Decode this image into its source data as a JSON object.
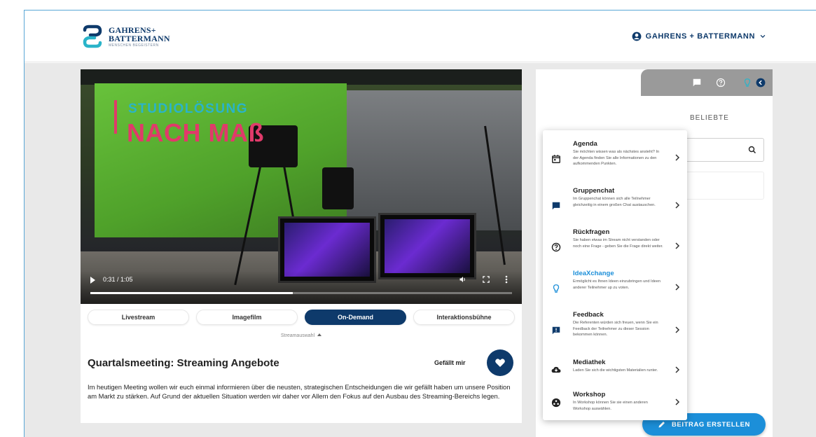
{
  "header": {
    "brand_name_line1": "GAHRENS+",
    "brand_name_line2": "BATTERMANN",
    "brand_tagline": "MENSCHEN BEGEISTERN",
    "account_name": "GAHRENS + BATTERMANN"
  },
  "video": {
    "overlay_line1": "STUDIOLÖSUNG",
    "overlay_line2": "NACH MAß",
    "timecode": "0:31 / 1:05",
    "progress": 0.48
  },
  "tabs": [
    {
      "label": "Livestream",
      "active": false
    },
    {
      "label": "Imagefilm",
      "active": false
    },
    {
      "label": "On-Demand",
      "active": true
    },
    {
      "label": "Interaktionsbühne",
      "active": false
    }
  ],
  "stream_select_label": "Streamauswahl",
  "meeting": {
    "title": "Quartalsmeeting: Streaming Angebote",
    "like_label": "Gefällt mir",
    "description": "Im heutigen Meeting wollen wir euch einmal informieren über die neusten, strategischen Entscheidungen die wir gefällt haben um unsere Position am Markt zu stärken. Auf Grund der aktuellen Situation werden wir daher vor Allem den Fokus auf den Ausbau des Streaming-Bereichs legen."
  },
  "sidebar": {
    "beliebte_label": "BELIEBTE",
    "create_button": "BEITRAG ERSTELLEN"
  },
  "menu": [
    {
      "title": "Agenda",
      "desc": "Sie möchten wissen was als nächstes ansteht? In der Agenda finden Sie alle Informationen zu den aufkommenden Punkten.",
      "icon": "calendar-icon"
    },
    {
      "title": "Gruppenchat",
      "desc": "Im Gruppenchat können sich alle Teilnehmer gleichzeitig in einem großen Chat austauschen.",
      "icon": "chat-icon"
    },
    {
      "title": "Rückfragen",
      "desc": "Sie haben etwas im Stream nicht verstanden oder noch eine Frage - geben Sie die Frage direkt weiter.",
      "icon": "question-icon"
    },
    {
      "title": "IdeaXchange",
      "desc": "Ermöglicht es Ihnen Ideen einzubringen und Ideen anderer Teilnehmer up zu voten.",
      "icon": "lightbulb-icon",
      "accent": true
    },
    {
      "title": "Feedback",
      "desc": "Die Referenten würden sich freuen, wenn Sie ein Feedback der Teilnehmer zu dieser Session bekommen können.",
      "icon": "feedback-icon"
    },
    {
      "title": "Mediathek",
      "desc": "Laden Sie sich die wichtigsten Materialien runter.",
      "icon": "cloud-download-icon"
    },
    {
      "title": "Workshop",
      "desc": "In Workshop können Sie sie einen anderen Workshop auswählen.",
      "icon": "workshop-icon"
    }
  ],
  "colors": {
    "brand_navy": "#0e3a6b",
    "accent_blue": "#1c8fd9",
    "overlay_cyan": "#2ab4c9",
    "overlay_pink": "#e03a6a"
  }
}
